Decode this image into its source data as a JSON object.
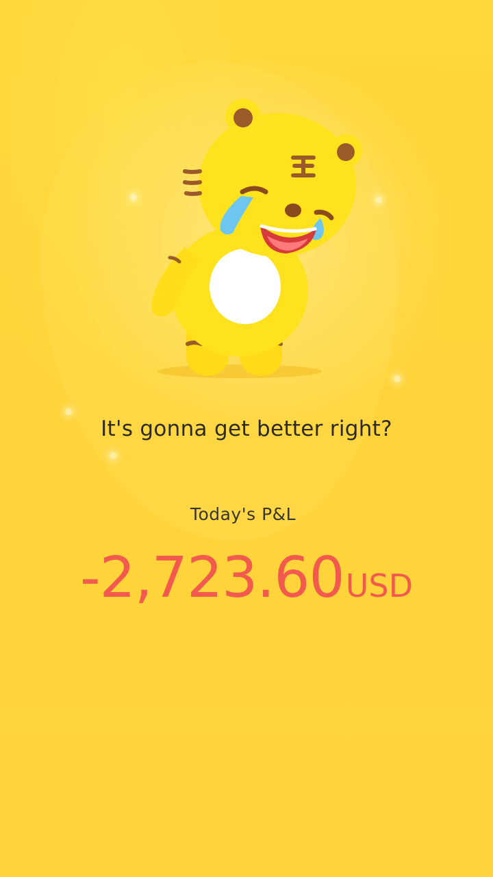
{
  "screen": {
    "message": "It's gonna get better right?",
    "pnl_label": "Today's P&L",
    "pnl_amount": "-2,723.60",
    "pnl_currency": "USD"
  },
  "mascot": {
    "icon": "crying-tiger-mascot-icon"
  },
  "colors": {
    "background": "#FFD63A",
    "message_text": "#2E2A22",
    "loss_text": "#F25A4E",
    "mascot_body": "#FFE21E",
    "mascot_stripes": "#9A5A2A"
  }
}
